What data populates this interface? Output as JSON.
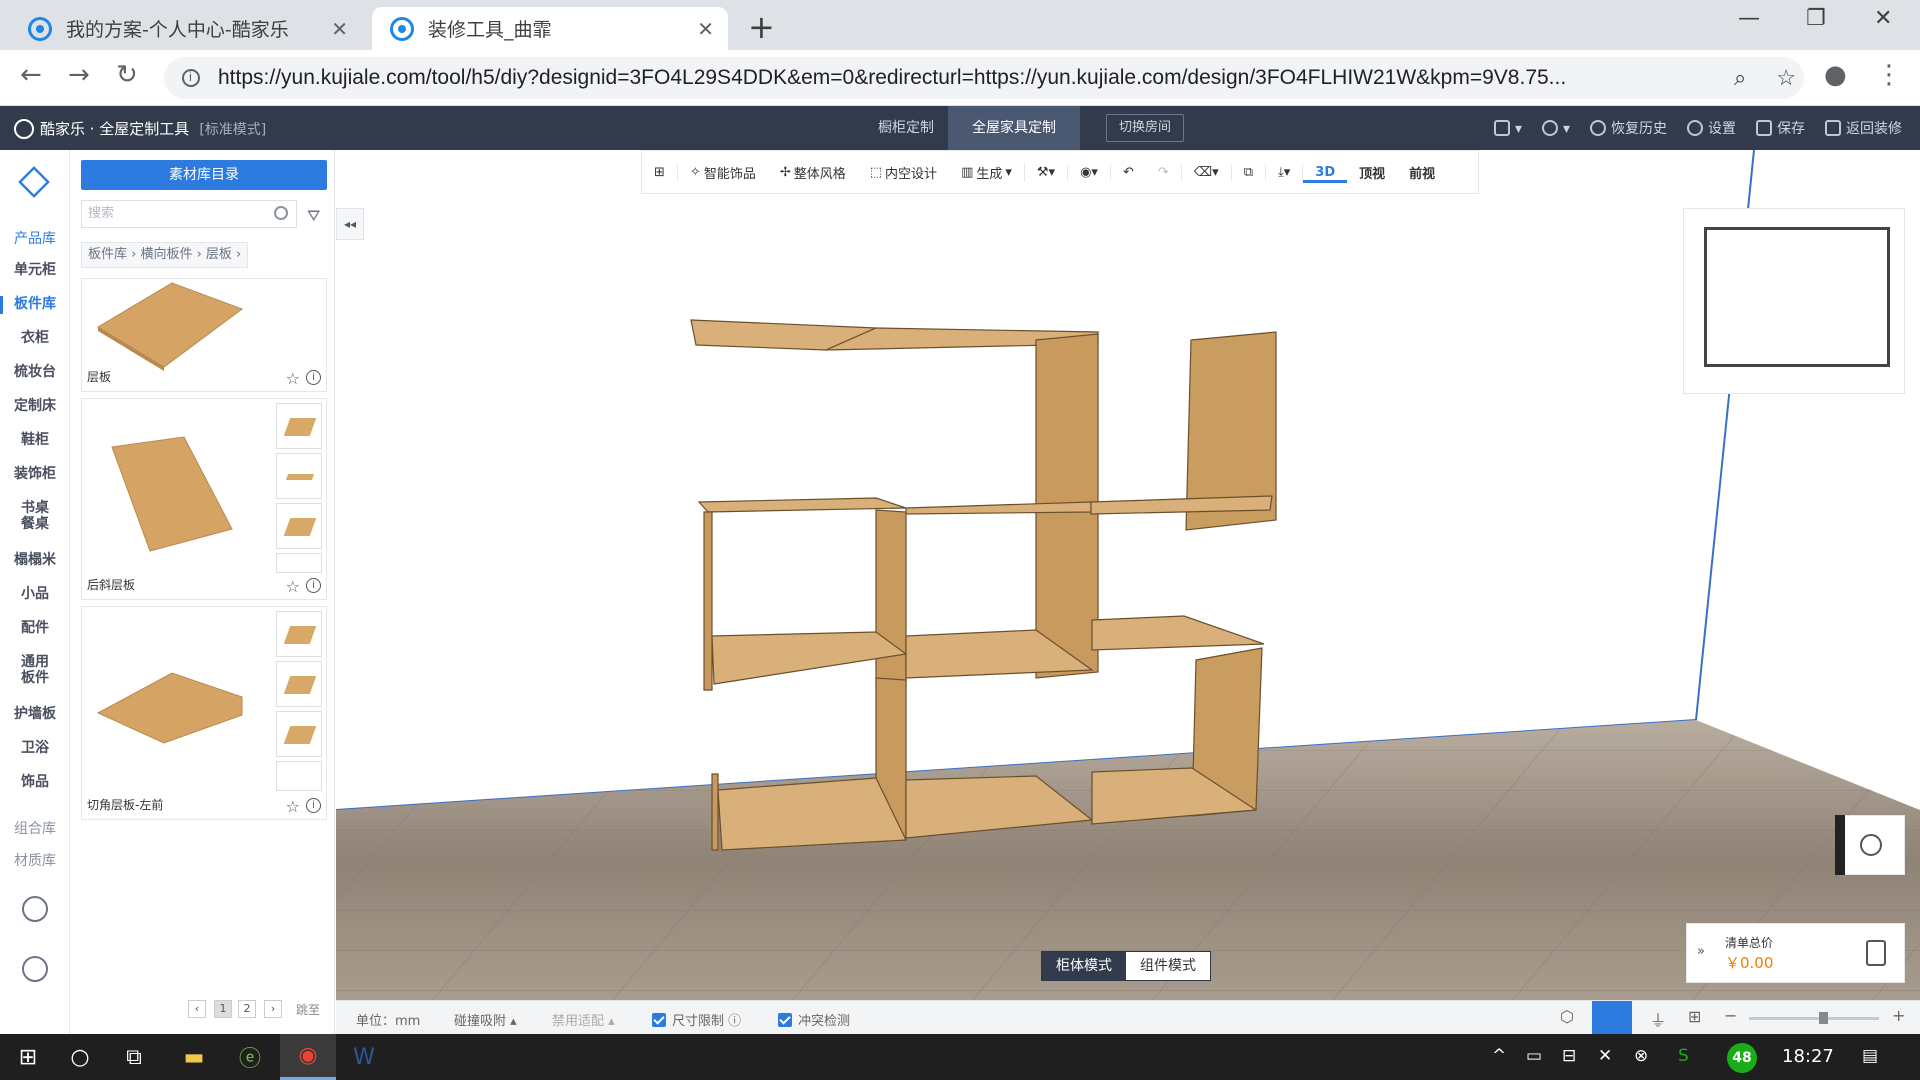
{
  "browser": {
    "tabs": [
      {
        "title": "我的方案-个人中心-酷家乐"
      },
      {
        "title": "装修工具_曲霏"
      }
    ],
    "url": "https://yun.kujiale.com/tool/h5/diy?designid=3FO4L29S4DDK&em=0&redirecturl=https://yun.kujiale.com/design/3FO4FLHIW21W&kpm=9V8.75..."
  },
  "app_header": {
    "brand": "酷家乐 · 全屋定制工具",
    "mode": "[标准模式]",
    "tabs": [
      "橱柜定制",
      "全屋家具定制"
    ],
    "active_tab": "全屋家具定制",
    "switch_room": "切换房间",
    "actions": [
      "恢复历史",
      "设置",
      "保存",
      "返回装修"
    ]
  },
  "left_nav": {
    "product_lib": "产品库",
    "items": [
      "单元柜",
      "板件库",
      "衣柜",
      "梳妆台",
      "定制床",
      "鞋柜",
      "装饰柜",
      "书桌\n餐桌",
      "榻榻米",
      "小品",
      "配件",
      "通用\n板件",
      "护墙板",
      "卫浴",
      "饰品"
    ],
    "active_item": "板件库",
    "combo_lib": "组合库",
    "material_lib": "材质库"
  },
  "panel": {
    "catalog_button": "素材库目录",
    "search_placeholder": "搜索",
    "breadcrumb": "板件库 › 横向板件 › 层板 ›",
    "cards": [
      {
        "name": "层板"
      },
      {
        "name": "后斜层板"
      },
      {
        "name": "切角层板-左前"
      }
    ],
    "pager": {
      "pages": [
        "1",
        "2"
      ],
      "jump": "跳至"
    }
  },
  "toolbar": {
    "items": [
      "智能饰品",
      "整体风格",
      "内空设计",
      "生成"
    ],
    "views": [
      "3D",
      "顶视",
      "前视"
    ],
    "active_view": "3D"
  },
  "mode_switch": {
    "on": "柜体模式",
    "off": "组件模式"
  },
  "total_price": {
    "label": "清单总价",
    "amount": "￥0.00"
  },
  "statusbar": {
    "unit": "单位：",
    "unit_value": "mm",
    "snap": "碰撞吸附",
    "disable_adapt": "禁用适配",
    "size_limit": "尺寸限制",
    "collision": "冲突检测"
  },
  "taskbar": {
    "time": "18:27",
    "badge": "48"
  },
  "colors": {
    "accent": "#2e7be0",
    "header_bg": "#323b4c",
    "wood": "#d7a866",
    "price": "#f08000"
  }
}
